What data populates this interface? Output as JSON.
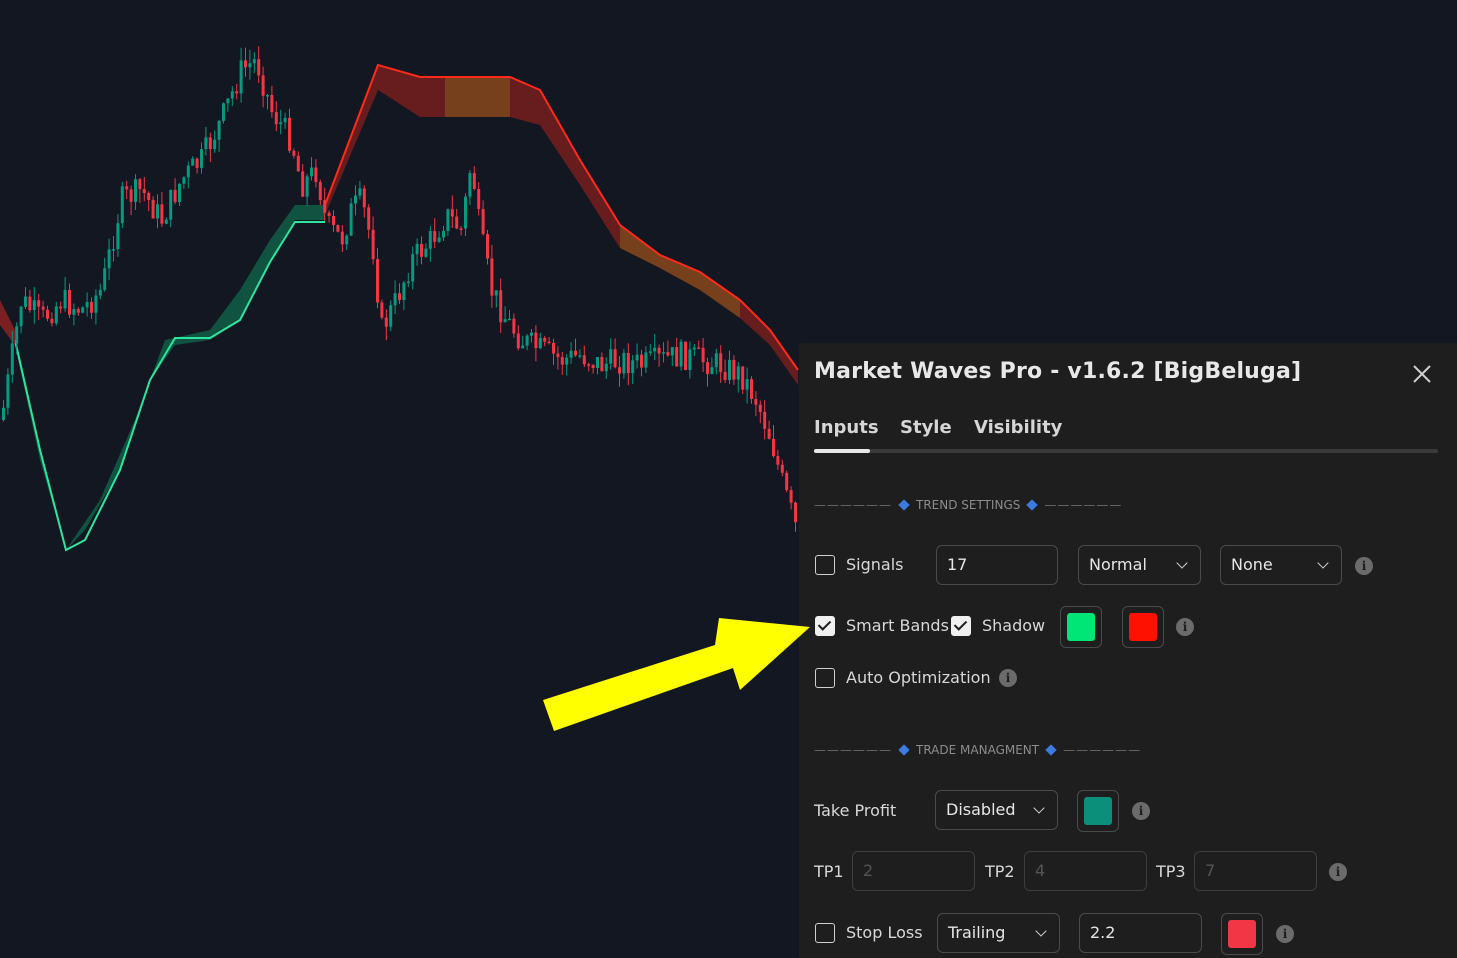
{
  "dialog": {
    "title": "Market Waves Pro - v1.6.2 [BigBeluga]",
    "tabs": [
      {
        "label": "Inputs",
        "active": true
      },
      {
        "label": "Style",
        "active": false
      },
      {
        "label": "Visibility",
        "active": false
      }
    ]
  },
  "trend_settings": {
    "header": "TREND SETTINGS",
    "signals": {
      "label": "Signals",
      "checked": false,
      "length_value": "17",
      "mode_value": "Normal",
      "filter_value": "None"
    },
    "smart_bands": {
      "label": "Smart Bands",
      "checked": true
    },
    "shadow": {
      "label": "Shadow",
      "checked": true
    },
    "band_colors": {
      "bull": "#00e676",
      "bear": "#ff1100"
    },
    "auto_optimization": {
      "label": "Auto Optimization",
      "checked": false
    }
  },
  "trade_management": {
    "header": "TRADE MANAGMENT",
    "take_profit": {
      "label": "Take Profit",
      "value": "Disabled",
      "color": "#0b8f7a"
    },
    "tp1": {
      "label": "TP1",
      "value": "2"
    },
    "tp2": {
      "label": "TP2",
      "value": "4"
    },
    "tp3": {
      "label": "TP3",
      "value": "7"
    },
    "stop_loss": {
      "label": "Stop Loss",
      "checked": false,
      "mode_value": "Trailing",
      "multiplier_value": "2.2",
      "color": "#f23645"
    }
  },
  "icons": {
    "close": "close-icon",
    "info": "info-icon",
    "checkmark": "checkmark-icon",
    "section_marker": "diamond-icon",
    "annotation": "arrow-icon"
  },
  "colors": {
    "background": "#131722",
    "panel": "#1e1e1e",
    "candle_up": "#089981",
    "candle_down": "#f23645",
    "arrow": "#ffff00"
  }
}
